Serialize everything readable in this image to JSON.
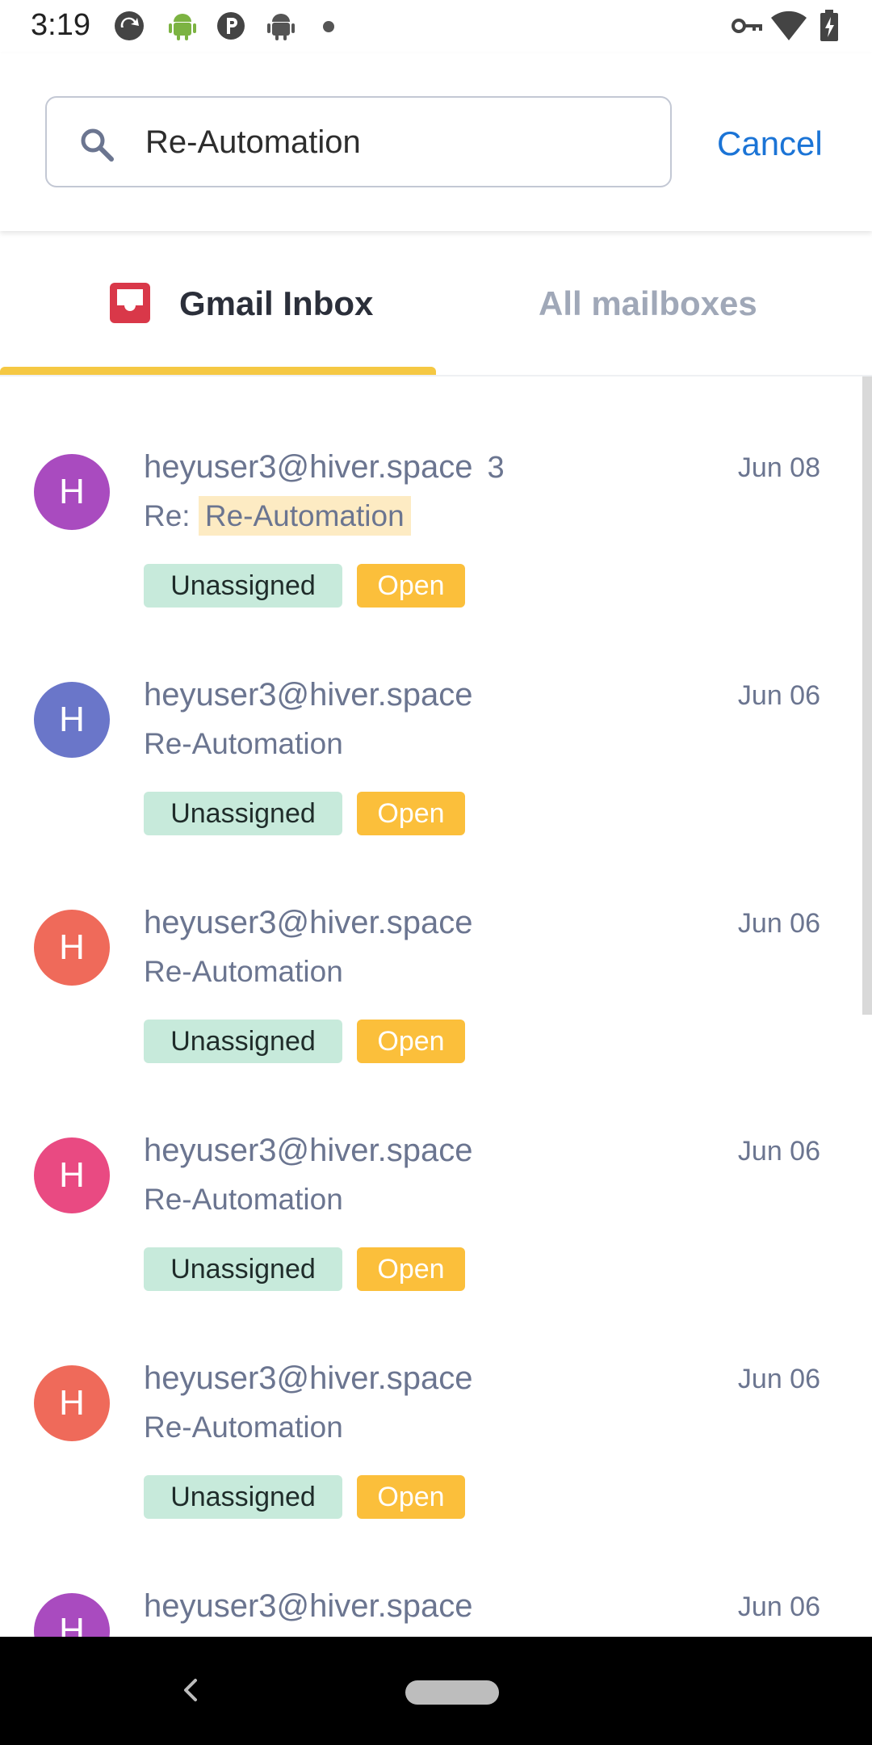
{
  "status_bar": {
    "time": "3:19",
    "icons": [
      "sync-icon",
      "android-icon",
      "parking-icon",
      "android-dark-icon",
      "dot-icon",
      "vpn-key-icon",
      "wifi-icon",
      "battery-charging-icon"
    ]
  },
  "search": {
    "query": "Re-Automation",
    "cancel_label": "Cancel"
  },
  "tabs": [
    {
      "label": "Gmail Inbox",
      "active": true,
      "icon": "inbox-icon"
    },
    {
      "label": "All mailboxes",
      "active": false
    }
  ],
  "emails": [
    {
      "initial": "H",
      "avatar_color": "#a94bbf",
      "sender": "heyuser3@hiver.space",
      "count": "3",
      "date": "Jun 08",
      "subject_prefix": "Re:",
      "subject": "Re-Automation",
      "highlight": true,
      "assignee": "Unassigned",
      "status": "Open"
    },
    {
      "initial": "H",
      "avatar_color": "#6a76c9",
      "sender": "heyuser3@hiver.space",
      "count": "",
      "date": "Jun 06",
      "subject_prefix": "",
      "subject": "Re-Automation",
      "highlight": false,
      "assignee": "Unassigned",
      "status": "Open"
    },
    {
      "initial": "H",
      "avatar_color": "#ef6a5a",
      "sender": "heyuser3@hiver.space",
      "count": "",
      "date": "Jun 06",
      "subject_prefix": "",
      "subject": "Re-Automation",
      "highlight": false,
      "assignee": "Unassigned",
      "status": "Open"
    },
    {
      "initial": "H",
      "avatar_color": "#e94a82",
      "sender": "heyuser3@hiver.space",
      "count": "",
      "date": "Jun 06",
      "subject_prefix": "",
      "subject": "Re-Automation",
      "highlight": false,
      "assignee": "Unassigned",
      "status": "Open"
    },
    {
      "initial": "H",
      "avatar_color": "#ef6a5a",
      "sender": "heyuser3@hiver.space",
      "count": "",
      "date": "Jun 06",
      "subject_prefix": "",
      "subject": "Re-Automation",
      "highlight": false,
      "assignee": "Unassigned",
      "status": "Open"
    },
    {
      "initial": "H",
      "avatar_color": "#a94bbf",
      "sender": "heyuser3@hiver.space",
      "count": "",
      "date": "Jun 06",
      "subject_prefix": "",
      "subject": "",
      "highlight": false,
      "assignee": "",
      "status": ""
    }
  ],
  "colors": {
    "accent": "#1b74d6",
    "tab_indicator": "#f5c843",
    "badge_unassigned": "#c7eadb",
    "badge_open": "#fbbf3b"
  }
}
